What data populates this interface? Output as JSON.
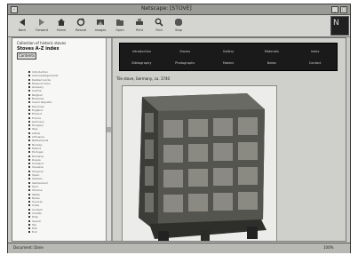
{
  "window": {
    "title": "Netscape: [STOVE]"
  },
  "toolbar": {
    "buttons": [
      {
        "label": "Back",
        "icon": "back-arrow-icon"
      },
      {
        "label": "Forward",
        "icon": "forward-arrow-icon"
      },
      {
        "label": "Home",
        "icon": "home-icon"
      },
      {
        "label": "Reload",
        "icon": "reload-icon"
      },
      {
        "label": "Images",
        "icon": "images-icon"
      },
      {
        "label": "Open",
        "icon": "open-icon"
      },
      {
        "label": "Print",
        "icon": "print-icon"
      },
      {
        "label": "Find",
        "icon": "find-icon"
      },
      {
        "label": "Stop",
        "icon": "stop-icon"
      }
    ],
    "logo": "N"
  },
  "nav": {
    "heading": "Collection of historic stoves",
    "subheading": "Stoves A-Z index",
    "back_button": "Contents",
    "items": [
      "Introduction",
      "Acknowledgements",
      "Related works",
      "Museum links",
      "Glossary",
      "Austria",
      "Belgium",
      "Bohemia",
      "Czech Republic",
      "Denmark",
      "England",
      "Finland",
      "France",
      "Germany",
      "Hungary",
      "Italy",
      "Latvia",
      "Lithuania",
      "Netherlands",
      "Norway",
      "Poland",
      "Portugal",
      "Romania",
      "Russia",
      "Scotland",
      "Slovakia",
      "Slovenia",
      "Spain",
      "Sweden",
      "Switzerland",
      "Tyrol",
      "Ukraine",
      "Wales",
      "Notes",
      "Sources",
      "Index",
      "Contact",
      "Credits",
      "Help",
      "Search",
      "Top",
      "Exit",
      "End"
    ]
  },
  "menu": {
    "items": [
      "Introduction",
      "Stoves",
      "Gallery",
      "Materials",
      "Index",
      "Bibliography",
      "Photographs",
      "Makers",
      "Notes",
      "Contact"
    ]
  },
  "main": {
    "caption": "Tile stove, Germany, ca. 1740"
  },
  "status": {
    "left": "Document: Done",
    "right": "100%"
  }
}
